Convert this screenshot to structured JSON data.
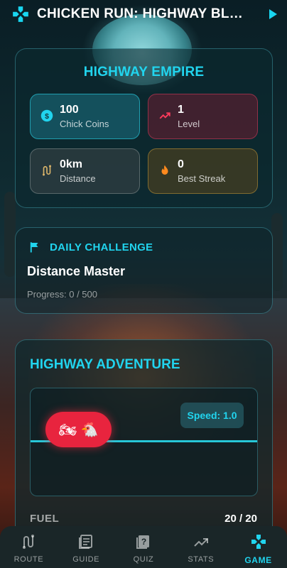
{
  "header": {
    "title": "CHICKEN RUN: HIGHWAY BL…"
  },
  "empire": {
    "title": "HIGHWAY EMPIRE",
    "stats": [
      {
        "value": "100",
        "label": "Chick Coins",
        "icon": "coin-icon"
      },
      {
        "value": "1",
        "label": "Level",
        "icon": "trending-up-icon"
      },
      {
        "value": "0km",
        "label": "Distance",
        "icon": "route-icon"
      },
      {
        "value": "0",
        "label": "Best Streak",
        "icon": "flame-icon"
      }
    ]
  },
  "challenge": {
    "heading": "DAILY CHALLENGE",
    "name": "Distance Master",
    "progress": "Progress: 0 / 500"
  },
  "adventure": {
    "title": "HIGHWAY ADVENTURE",
    "speed": "Speed: 1.0",
    "player_emoji": "🏍 🐔",
    "fuel_label": "FUEL",
    "fuel_value": "20 / 20"
  },
  "nav": {
    "items": [
      {
        "label": "ROUTE",
        "icon": "route-icon"
      },
      {
        "label": "GUIDE",
        "icon": "book-icon"
      },
      {
        "label": "QUIZ",
        "icon": "quiz-icon"
      },
      {
        "label": "STATS",
        "icon": "chart-icon"
      },
      {
        "label": "GAME",
        "icon": "gamepad-icon",
        "active": true
      }
    ]
  },
  "colors": {
    "accent": "#21d4ee",
    "danger": "#e8243e"
  }
}
